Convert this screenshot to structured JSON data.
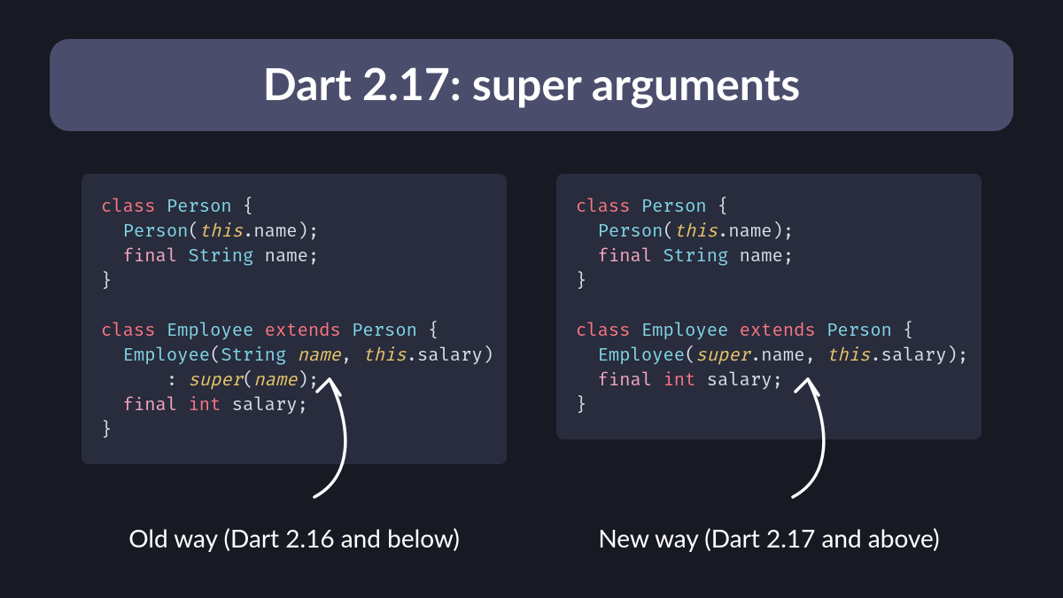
{
  "title": "Dart 2.17: super arguments",
  "left": {
    "caption": "Old way (Dart 2.16 and below)",
    "code": [
      [
        [
          "kw",
          "class"
        ],
        [
          "",
          ""
        ],
        [
          "",
          " "
        ],
        [
          "type",
          "Person"
        ],
        [
          "",
          ""
        ],
        [
          "",
          " "
        ],
        [
          "punc",
          "{"
        ]
      ],
      [
        [
          "",
          "  "
        ],
        [
          "type",
          "Person"
        ],
        [
          "punc",
          "("
        ],
        [
          "this",
          "this"
        ],
        [
          "punc",
          "."
        ],
        [
          "",
          "name"
        ],
        [
          "punc",
          ");"
        ]
      ],
      [
        [
          "",
          "  "
        ],
        [
          "mod",
          "final"
        ],
        [
          "",
          ""
        ],
        [
          "",
          " "
        ],
        [
          "type",
          "String"
        ],
        [
          "",
          ""
        ],
        [
          "",
          " "
        ],
        [
          "",
          "name"
        ],
        [
          "punc",
          ";"
        ]
      ],
      [
        [
          "punc",
          "}"
        ]
      ],
      [
        [
          "",
          ""
        ]
      ],
      [
        [
          "kw",
          "class"
        ],
        [
          "",
          ""
        ],
        [
          "",
          " "
        ],
        [
          "type",
          "Employee"
        ],
        [
          "",
          ""
        ],
        [
          "",
          " "
        ],
        [
          "kw",
          "extends"
        ],
        [
          "",
          ""
        ],
        [
          "",
          " "
        ],
        [
          "type",
          "Person"
        ],
        [
          "",
          ""
        ],
        [
          "",
          " "
        ],
        [
          "punc",
          "{"
        ]
      ],
      [
        [
          "",
          "  "
        ],
        [
          "type",
          "Employee"
        ],
        [
          "punc",
          "("
        ],
        [
          "type",
          "String"
        ],
        [
          "",
          " "
        ],
        [
          "param",
          "name"
        ],
        [
          "punc",
          ","
        ],
        [
          "",
          " "
        ],
        [
          "this",
          "this"
        ],
        [
          "punc",
          "."
        ],
        [
          "",
          "salary"
        ],
        [
          "punc",
          ")"
        ]
      ],
      [
        [
          "",
          "      "
        ],
        [
          "punc",
          ":"
        ],
        [
          "",
          " "
        ],
        [
          "this",
          "super"
        ],
        [
          "punc",
          "("
        ],
        [
          "param",
          "name"
        ],
        [
          "punc",
          ");"
        ]
      ],
      [
        [
          "",
          "  "
        ],
        [
          "mod",
          "final"
        ],
        [
          "",
          ""
        ],
        [
          "",
          " "
        ],
        [
          "kw",
          "int"
        ],
        [
          "",
          ""
        ],
        [
          "",
          " "
        ],
        [
          "",
          "salary"
        ],
        [
          "punc",
          ";"
        ]
      ],
      [
        [
          "punc",
          "}"
        ]
      ]
    ]
  },
  "right": {
    "caption": "New way (Dart 2.17 and above)",
    "code": [
      [
        [
          "kw",
          "class"
        ],
        [
          "",
          ""
        ],
        [
          "",
          " "
        ],
        [
          "type",
          "Person"
        ],
        [
          "",
          ""
        ],
        [
          "",
          " "
        ],
        [
          "punc",
          "{"
        ]
      ],
      [
        [
          "",
          "  "
        ],
        [
          "type",
          "Person"
        ],
        [
          "punc",
          "("
        ],
        [
          "this",
          "this"
        ],
        [
          "punc",
          "."
        ],
        [
          "",
          "name"
        ],
        [
          "punc",
          ");"
        ]
      ],
      [
        [
          "",
          "  "
        ],
        [
          "mod",
          "final"
        ],
        [
          "",
          ""
        ],
        [
          "",
          " "
        ],
        [
          "type",
          "String"
        ],
        [
          "",
          ""
        ],
        [
          "",
          " "
        ],
        [
          "",
          "name"
        ],
        [
          "punc",
          ";"
        ]
      ],
      [
        [
          "punc",
          "}"
        ]
      ],
      [
        [
          "",
          ""
        ]
      ],
      [
        [
          "kw",
          "class"
        ],
        [
          "",
          ""
        ],
        [
          "",
          " "
        ],
        [
          "type",
          "Employee"
        ],
        [
          "",
          ""
        ],
        [
          "",
          " "
        ],
        [
          "kw",
          "extends"
        ],
        [
          "",
          ""
        ],
        [
          "",
          " "
        ],
        [
          "type",
          "Person"
        ],
        [
          "",
          ""
        ],
        [
          "",
          " "
        ],
        [
          "punc",
          "{"
        ]
      ],
      [
        [
          "",
          "  "
        ],
        [
          "type",
          "Employee"
        ],
        [
          "punc",
          "("
        ],
        [
          "this",
          "super"
        ],
        [
          "punc",
          "."
        ],
        [
          "",
          "name"
        ],
        [
          "punc",
          ","
        ],
        [
          "",
          " "
        ],
        [
          "this",
          "this"
        ],
        [
          "punc",
          "."
        ],
        [
          "",
          "salary"
        ],
        [
          "punc",
          ");"
        ]
      ],
      [
        [
          "",
          "  "
        ],
        [
          "mod",
          "final"
        ],
        [
          "",
          ""
        ],
        [
          "",
          " "
        ],
        [
          "kw",
          "int"
        ],
        [
          "",
          ""
        ],
        [
          "",
          " "
        ],
        [
          "",
          "salary"
        ],
        [
          "punc",
          ";"
        ]
      ],
      [
        [
          "punc",
          "}"
        ]
      ]
    ]
  }
}
